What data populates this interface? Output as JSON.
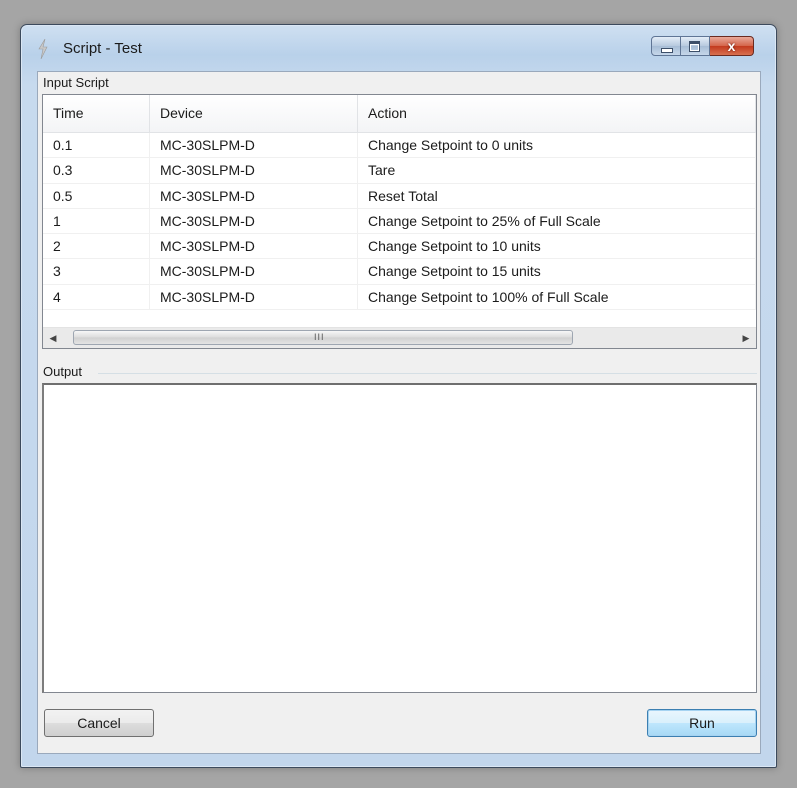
{
  "window": {
    "title": "Script - Test",
    "close_glyph": "x"
  },
  "input_script": {
    "label": "Input Script",
    "columns": [
      "Time",
      "Device",
      "Action"
    ],
    "rows": [
      {
        "time": "0.1",
        "device": "MC-30SLPM-D",
        "action": "Change Setpoint to 0 units"
      },
      {
        "time": "0.3",
        "device": "MC-30SLPM-D",
        "action": "Tare"
      },
      {
        "time": "0.5",
        "device": "MC-30SLPM-D",
        "action": "Reset Total"
      },
      {
        "time": "1",
        "device": "MC-30SLPM-D",
        "action": "Change Setpoint to 25% of Full Scale"
      },
      {
        "time": "2",
        "device": "MC-30SLPM-D",
        "action": "Change Setpoint to 10 units"
      },
      {
        "time": "3",
        "device": "MC-30SLPM-D",
        "action": "Change Setpoint to 15 units"
      },
      {
        "time": "4",
        "device": "MC-30SLPM-D",
        "action": "Change Setpoint to 100% of Full Scale"
      }
    ],
    "scrollbar": {
      "left_arrow": "◀",
      "right_arrow": "▶",
      "grip": "III"
    }
  },
  "output": {
    "label": "Output",
    "text": ""
  },
  "buttons": {
    "cancel": "Cancel",
    "run": "Run"
  }
}
